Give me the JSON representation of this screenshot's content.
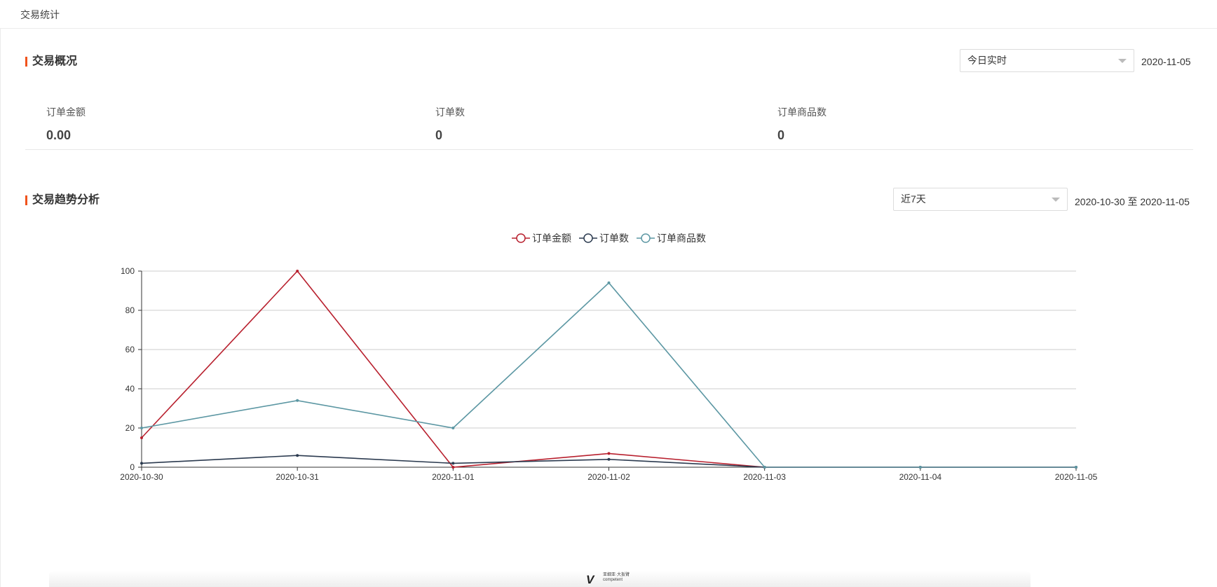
{
  "breadcrumb": "交易统计",
  "overview": {
    "title": "交易概况",
    "range_select": "今日实时",
    "date": "2020-11-05",
    "metrics": [
      {
        "label": "订单金额",
        "value": "0.00"
      },
      {
        "label": "订单数",
        "value": "0"
      },
      {
        "label": "订单商品数",
        "value": "0"
      }
    ]
  },
  "trend": {
    "title": "交易趋势分析",
    "range_select": "近7天",
    "date_range": "2020-10-30 至 2020-11-05"
  },
  "colors": {
    "accent": "#f0531c",
    "series": [
      "#b8202e",
      "#2b3a4f",
      "#5c97a3"
    ]
  },
  "chart_data": {
    "type": "line",
    "x": [
      "2020-10-30",
      "2020-10-31",
      "2020-11-01",
      "2020-11-02",
      "2020-11-03",
      "2020-11-04",
      "2020-11-05"
    ],
    "series": [
      {
        "name": "订单金额",
        "values": [
          15,
          100,
          0,
          7,
          0,
          0,
          0
        ]
      },
      {
        "name": "订单数",
        "values": [
          2,
          6,
          2,
          4,
          0,
          0,
          0
        ]
      },
      {
        "name": "订单商品数",
        "values": [
          20,
          34,
          20,
          94,
          0,
          0,
          0
        ]
      }
    ],
    "ylim": [
      0,
      100
    ],
    "yticks": [
      0,
      20,
      40,
      60,
      80,
      100
    ],
    "grid": true,
    "legend": "top-center"
  },
  "footer": {
    "logo_mark": "V",
    "logo_line1": "亚细亚·大扳臂",
    "logo_line2": "competent"
  }
}
